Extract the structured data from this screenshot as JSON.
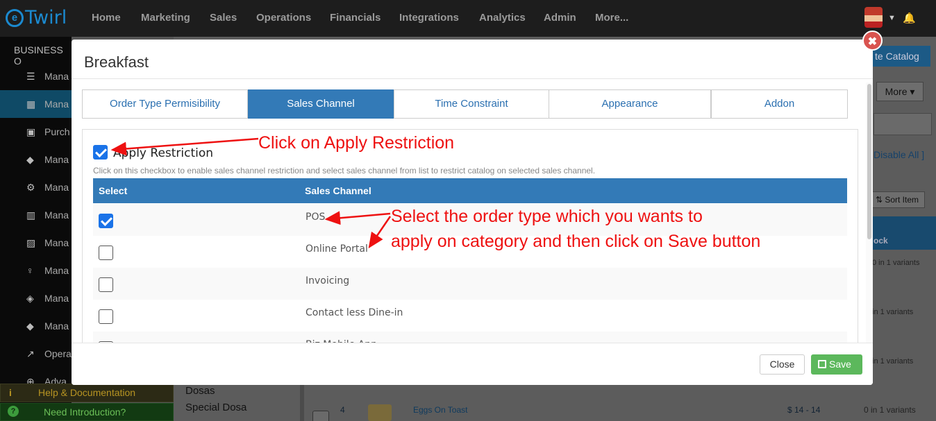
{
  "app": {
    "brand": "Twirl",
    "nav": [
      "Home",
      "Marketing",
      "Sales",
      "Operations",
      "Financials",
      "Integrations",
      "Analytics",
      "Admin",
      "More..."
    ]
  },
  "sidebar": {
    "title": "BUSINESS O",
    "items": [
      {
        "icon": "list-icon",
        "label": "Mana"
      },
      {
        "icon": "table-icon",
        "label": "Mana",
        "active": true
      },
      {
        "icon": "document-icon",
        "label": "Purch"
      },
      {
        "icon": "tags-icon",
        "label": "Mana"
      },
      {
        "icon": "cogs-icon",
        "label": "Mana"
      },
      {
        "icon": "bank-icon",
        "label": "Mana"
      },
      {
        "icon": "image-icon",
        "label": "Mana"
      },
      {
        "icon": "person-icon",
        "label": "Mana"
      },
      {
        "icon": "ticket-icon",
        "label": "Mana"
      },
      {
        "icon": "tags-icon",
        "label": "Mana"
      },
      {
        "icon": "chart-icon",
        "label": "Opera"
      },
      {
        "icon": "plus-circle-icon",
        "label": "Adva"
      }
    ],
    "help": "Help & Documentation",
    "intro": "Need Introduction?"
  },
  "background": {
    "catalog_button": "te Catalog",
    "more_button": "More",
    "disable_all": "Disable All ]",
    "sort_item": "Sort Item",
    "column_header": "ock",
    "variants": [
      "0 in 1 variants",
      "in 1 variants",
      "in 1 variants",
      "0 in 1 variants"
    ],
    "categories": [
      "Dosas",
      "Special Dosa"
    ],
    "row": {
      "index": "4",
      "name": "Eggs On Toast",
      "price": "$ 14 - 14",
      "variants": "0 in 1 variants"
    }
  },
  "modal": {
    "title": "Breakfast",
    "tabs": [
      {
        "label": "Order Type Permisibility",
        "active": false
      },
      {
        "label": "Sales Channel",
        "active": true
      },
      {
        "label": "Time Constraint",
        "active": false
      },
      {
        "label": "Appearance",
        "active": false
      },
      {
        "label": "Addon",
        "active": false
      }
    ],
    "apply_restriction": {
      "label": "Apply Restriction",
      "checked": true
    },
    "help_text": "Click on this checkbox to enable sales channel restriction and select sales channel from list to restrict catalog on selected sales channel.",
    "table": {
      "headers": [
        "Select",
        "Sales Channel"
      ],
      "rows": [
        {
          "name": "POS",
          "checked": true
        },
        {
          "name": "Online Portal",
          "checked": false
        },
        {
          "name": "Invoicing",
          "checked": false
        },
        {
          "name": "Contact less Dine-in",
          "checked": false
        },
        {
          "name": "Biz Mobile App",
          "checked": false
        }
      ]
    },
    "buttons": {
      "close": "Close",
      "save": "Save"
    }
  },
  "annotations": {
    "apply": "Click on Apply Restriction",
    "select_line1": "Select the order type which you wants to",
    "select_line2": "apply on category and then click on Save button",
    "color": "#e11111"
  }
}
